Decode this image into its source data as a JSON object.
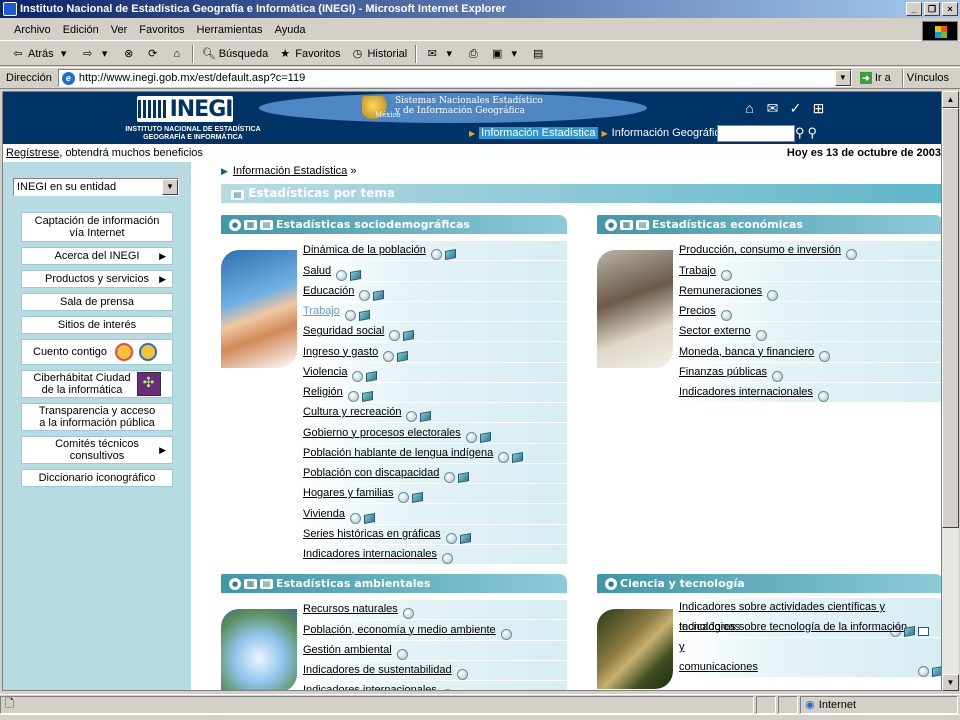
{
  "window": {
    "title": "Instituto Nacional de Estadística Geografía e Informática (INEGI) - Microsoft Internet Explorer",
    "controls": [
      "_",
      "❐",
      "×"
    ]
  },
  "menu": [
    "Archivo",
    "Edición",
    "Ver",
    "Favoritos",
    "Herramientas",
    "Ayuda"
  ],
  "toolbar": {
    "back": "Atrás",
    "search": "Búsqueda",
    "favorites": "Favoritos",
    "history": "Historial"
  },
  "address": {
    "label": "Dirección",
    "url": "http://www.inegi.gob.mx/est/default.asp?c=119",
    "go": "Ir a",
    "links": "Vínculos"
  },
  "header": {
    "logo": "INEGI",
    "institute": "INSTITUTO NACIONAL DE ESTADÍSTICA GEOGRAFÍA E INFORMÁTICA",
    "sns_line1": "Sistemas Nacionales Estadístico",
    "sns_line2": "y de Información Geográfica",
    "mexico": "México",
    "nav_active": "Información Estadística",
    "nav_other": "Información Geográfica"
  },
  "register": {
    "link": "Regístrese",
    "text": ", obtendrá muchos beneficios"
  },
  "today": "Hoy es 13 de octubre de 2003",
  "entidad_select": "INEGI en su entidad",
  "sidebar": [
    {
      "label": "Captación de información\nvía Internet",
      "arrow": false,
      "h": 30
    },
    {
      "label": "Acerca del INEGI",
      "arrow": true,
      "h": 18
    },
    {
      "label": "Productos y servicios",
      "arrow": true,
      "h": 18
    },
    {
      "label": "Sala de prensa",
      "arrow": false,
      "h": 18
    },
    {
      "label": "Sitios de interés",
      "arrow": false,
      "h": 18
    },
    {
      "label": "Cuento contigo",
      "arrow": false,
      "h": 26,
      "extra": "kids"
    },
    {
      "label": "Ciberhábitat Ciudad\nde la informática",
      "arrow": false,
      "h": 28,
      "extra": "ciber"
    },
    {
      "label": "Transparencia y acceso\na la información pública",
      "arrow": false,
      "h": 28
    },
    {
      "label": "Comités técnicos\nconsultivos",
      "arrow": true,
      "h": 28
    },
    {
      "label": "Diccionario iconográfico",
      "arrow": false,
      "h": 18
    }
  ],
  "breadcrumb": {
    "link": "Información Estadística",
    "sep": "»"
  },
  "main_title": "Estadísticas por tema",
  "panels": {
    "socio": {
      "title": "Estadísticas sociodemográficas",
      "items": [
        {
          "label": "Dinámica de la población",
          "icons": "cb"
        },
        {
          "label": "Salud",
          "icons": "cb"
        },
        {
          "label": "Educación",
          "icons": "cb"
        },
        {
          "label": "Trabajo",
          "icons": "cb",
          "visited": true
        },
        {
          "label": "Seguridad social",
          "icons": "cb"
        },
        {
          "label": "Ingreso y gasto",
          "icons": "cb"
        },
        {
          "label": "Violencia",
          "icons": "cb"
        },
        {
          "label": "Religión",
          "icons": "cb"
        },
        {
          "label": "Cultura y recreación",
          "icons": "cb"
        },
        {
          "label": "Gobierno y procesos electorales",
          "icons": "cb"
        },
        {
          "label": "Población hablante de lengua indígena",
          "icons": "cb"
        },
        {
          "label": "Población con discapacidad",
          "icons": "cb"
        },
        {
          "label": "Hogares y familias",
          "icons": "cb"
        },
        {
          "label": "Vivienda",
          "icons": "cb"
        },
        {
          "label": "Series históricas en gráficas",
          "icons": "cb"
        },
        {
          "label": "Indicadores internacionales",
          "icons": "c"
        }
      ]
    },
    "econ": {
      "title": "Estadísticas económicas",
      "items": [
        {
          "label": "Producción, consumo e inversión",
          "icons": "c"
        },
        {
          "label": "Trabajo",
          "icons": "c"
        },
        {
          "label": "Remuneraciones",
          "icons": "c"
        },
        {
          "label": "Precios",
          "icons": "c"
        },
        {
          "label": "Sector externo",
          "icons": "c"
        },
        {
          "label": "Moneda, banca y financiero",
          "icons": "c"
        },
        {
          "label": "Finanzas públicas",
          "icons": "c"
        },
        {
          "label": "Indicadores internacionales",
          "icons": "c"
        }
      ]
    },
    "amb": {
      "title": "Estadísticas ambientales",
      "items": [
        {
          "label": "Recursos naturales",
          "icons": "c"
        },
        {
          "label": "Población, economía y medio ambiente",
          "icons": "c"
        },
        {
          "label": "Gestión ambiental",
          "icons": "c"
        },
        {
          "label": "Indicadores de sustentabilidad",
          "icons": "c"
        },
        {
          "label": "Indicadores internacionales",
          "icons": "c"
        }
      ]
    },
    "cyt": {
      "title": "Ciencia y tecnología",
      "items": [
        {
          "label": "Indicadores sobre actividades científicas y\ntecnológicas",
          "icons": "cbt"
        },
        {
          "label": "Indicadores sobre tecnología de la información y\ncomunicaciones",
          "icons": "cb"
        }
      ]
    }
  },
  "status": {
    "zone": "Internet"
  }
}
